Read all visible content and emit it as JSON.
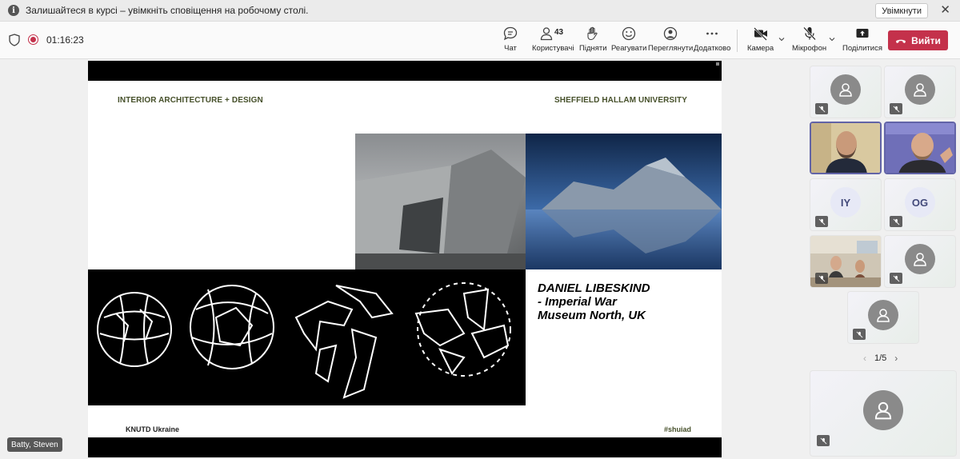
{
  "notification": {
    "text": "Залишайтеся в курсі – увімкніть сповіщення на робочому столі.",
    "button": "Увімкнути",
    "close": "✕"
  },
  "toolbar": {
    "timer": "01:16:23",
    "chat": "Чат",
    "people": "Користувачі",
    "people_count": "43",
    "raise": "Підняти",
    "react": "Реагувати",
    "view": "Переглянути",
    "more": "Додатково",
    "camera": "Камера",
    "mic": "Мікрофон",
    "share": "Поділитися",
    "leave": "Вийти"
  },
  "slide": {
    "header_left": "INTERIOR ARCHITECTURE + DESIGN",
    "header_right": "SHEFFIELD HALLAM UNIVERSITY",
    "caption_line1": "DANIEL LIBESKIND",
    "caption_line2": "- Imperial War",
    "caption_line3": "Museum North, UK",
    "footer_left": "KNUTD Ukraine",
    "footer_right": "#shuiad"
  },
  "presenter_name": "Batty, Steven",
  "participants": {
    "initials1": "IY",
    "initials2": "OG"
  },
  "pager": {
    "label": "1/5",
    "prev": "‹",
    "next": "›"
  },
  "colors": {
    "accent": "#6264a7",
    "leave": "#c4314b",
    "slide_text": "#46502a"
  }
}
